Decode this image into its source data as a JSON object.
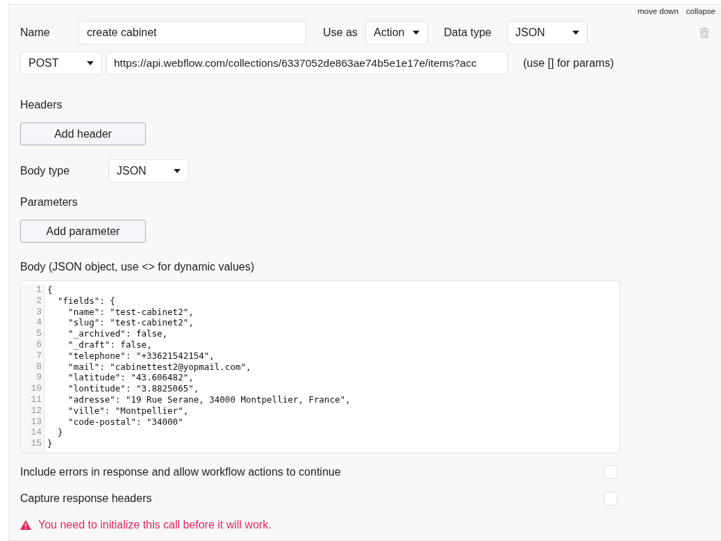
{
  "panel_links": [
    "move down",
    "collapse"
  ],
  "name": {
    "label": "Name",
    "value": "create cabinet"
  },
  "use_as": {
    "label": "Use as",
    "value": "Action"
  },
  "data_type": {
    "label": "Data type",
    "value": "JSON"
  },
  "method": {
    "value": "POST"
  },
  "url": {
    "value": "https://api.webflow.com/collections/6337052de863ae74b5e1e17e/items?acc"
  },
  "url_hint": "(use [] for params)",
  "headers": {
    "label": "Headers",
    "button": "Add header"
  },
  "body_type": {
    "label": "Body type",
    "value": "JSON"
  },
  "parameters": {
    "label": "Parameters",
    "button": "Add parameter"
  },
  "body": {
    "label": "Body (JSON object, use <> for dynamic values)",
    "lines": [
      {
        "number": "1",
        "text": "{"
      },
      {
        "number": "2",
        "text": "  \"fields\": {"
      },
      {
        "number": "3",
        "text": "    \"name\": \"test-cabinet2\","
      },
      {
        "number": "4",
        "text": "    \"slug\": \"test-cabinet2\","
      },
      {
        "number": "5",
        "text": "    \"_archived\": false,"
      },
      {
        "number": "6",
        "text": "    \"_draft\": false,"
      },
      {
        "number": "7",
        "text": "    \"telephone\": \"+33621542154\","
      },
      {
        "number": "8",
        "text": "    \"mail\": \"cabinettest2@yopmail.com\","
      },
      {
        "number": "9",
        "text": "    \"latitude\": \"43.606482\","
      },
      {
        "number": "10",
        "text": "    \"lontitude\": \"3.8825065\","
      },
      {
        "number": "11",
        "text": "    \"adresse\": \"19 Rue Serane, 34000 Montpellier, France\","
      },
      {
        "number": "12",
        "text": "    \"ville\": \"Montpellier\","
      },
      {
        "number": "13",
        "text": "    \"code-postal\": \"34000\""
      },
      {
        "number": "14",
        "text": "  }"
      },
      {
        "number": "15",
        "text": "}"
      }
    ]
  },
  "options": [
    {
      "label": "Include errors in response and allow workflow actions to continue",
      "checked": false
    },
    {
      "label": "Capture response headers",
      "checked": false
    }
  ],
  "warning": "You need to initialize this call before it will work."
}
